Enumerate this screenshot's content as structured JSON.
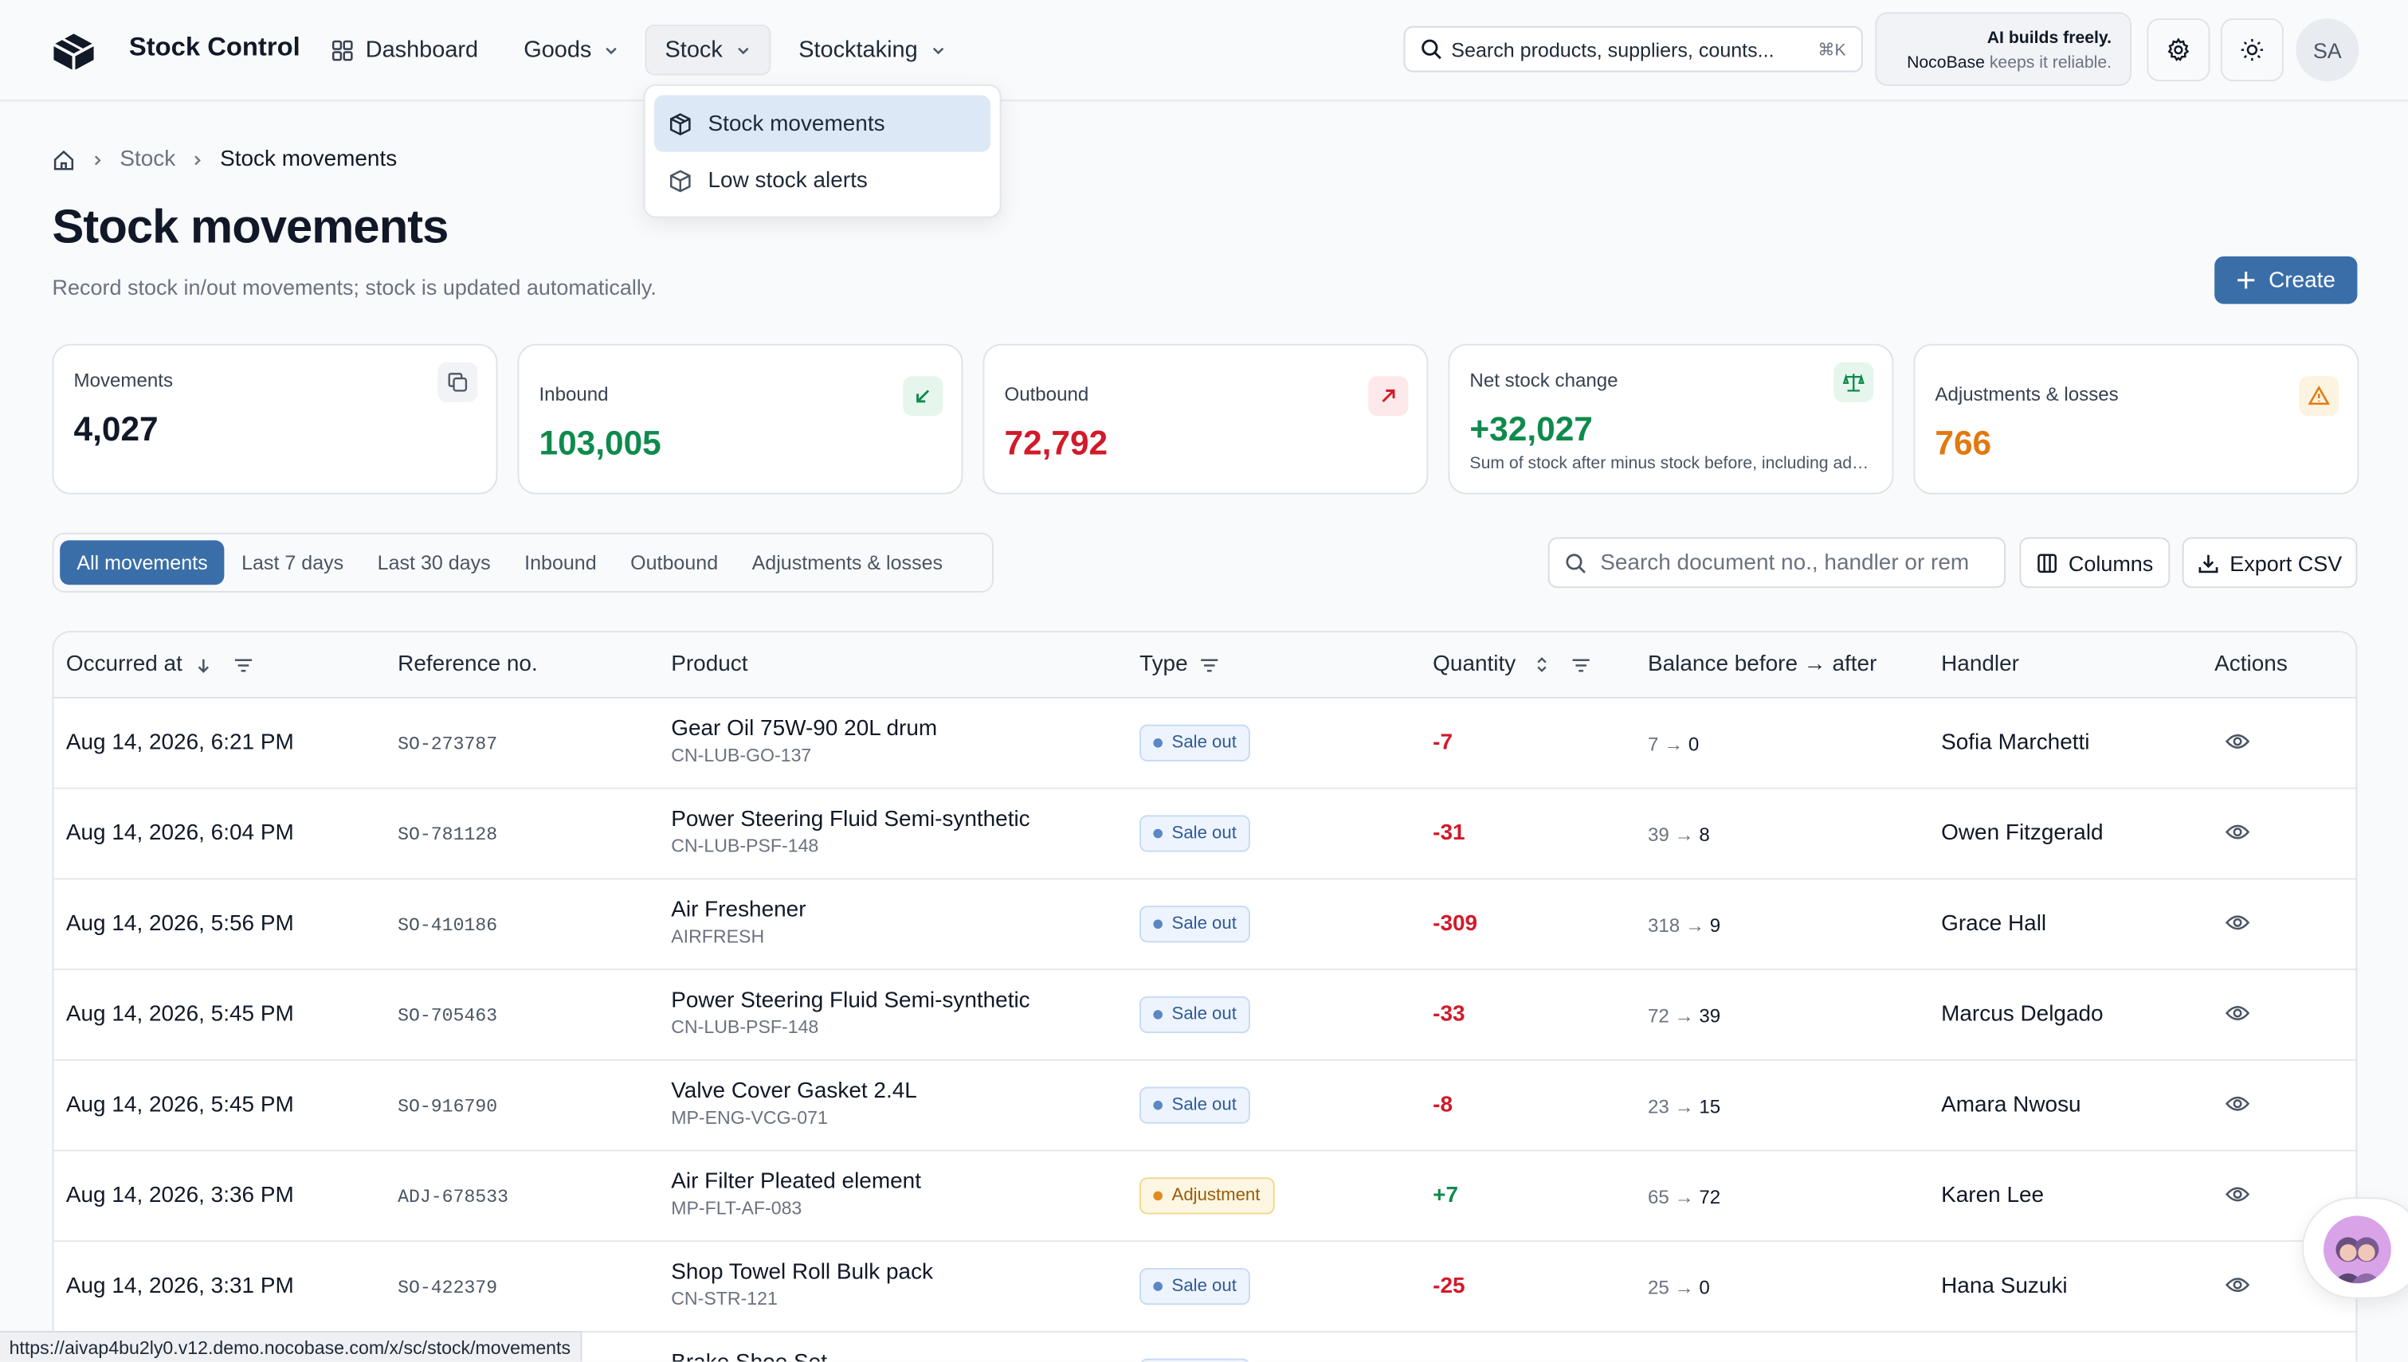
{
  "header": {
    "app_title": "Stock Control",
    "nav": [
      {
        "label": "Dashboard"
      },
      {
        "label": "Goods"
      },
      {
        "label": "Stock"
      },
      {
        "label": "Stocktaking"
      }
    ],
    "search_placeholder": "Search products, suppliers, counts...",
    "search_shortcut": "⌘K",
    "ai_line1": "AI builds freely.",
    "ai_brand": "NocoBase",
    "ai_line2": "keeps it reliable.",
    "avatar_initials": "SA"
  },
  "dropdown": {
    "items": [
      {
        "label": "Stock movements"
      },
      {
        "label": "Low stock alerts"
      }
    ]
  },
  "breadcrumb": {
    "parent": "Stock",
    "current": "Stock movements"
  },
  "page": {
    "title": "Stock movements",
    "subtitle": "Record stock in/out movements; stock is updated automatically.",
    "create_label": "Create"
  },
  "stats": [
    {
      "label": "Movements",
      "value": "4,027",
      "color": "#111827"
    },
    {
      "label": "Inbound",
      "value": "103,005",
      "color": "#0f8a4c"
    },
    {
      "label": "Outbound",
      "value": "72,792",
      "color": "#d11a2a"
    },
    {
      "label": "Net stock change",
      "value": "+32,027",
      "color": "#0f8a4c",
      "foot": "Sum of stock after minus stock before, including adjustments and losses"
    },
    {
      "label": "Adjustments & losses",
      "value": "766",
      "color": "#e07a10"
    }
  ],
  "filters": {
    "tabs": [
      "All movements",
      "Last 7 days",
      "Last 30 days",
      "Inbound",
      "Outbound",
      "Adjustments & losses"
    ],
    "search_placeholder": "Search document no., handler or remarks",
    "columns_label": "Columns",
    "export_label": "Export CSV"
  },
  "table": {
    "columns": [
      "Occurred at",
      "Reference no.",
      "Product",
      "Type",
      "Quantity",
      "Balance before → after",
      "Handler",
      "Actions"
    ],
    "rows": [
      {
        "date": "Aug 14, 2026, 6:21 PM",
        "ref": "SO-273787",
        "product": "Gear Oil 75W-90 20L drum",
        "sku": "CN-LUB-GO-137",
        "type": "Sale out",
        "qty": "-7",
        "before": "7",
        "after": "0",
        "handler": "Sofia Marchetti"
      },
      {
        "date": "Aug 14, 2026, 6:04 PM",
        "ref": "SO-781128",
        "product": "Power Steering Fluid Semi-synthetic",
        "sku": "CN-LUB-PSF-148",
        "type": "Sale out",
        "qty": "-31",
        "before": "39",
        "after": "8",
        "handler": "Owen Fitzgerald"
      },
      {
        "date": "Aug 14, 2026, 5:56 PM",
        "ref": "SO-410186",
        "product": "Air Freshener",
        "sku": "AIRFRESH",
        "type": "Sale out",
        "qty": "-309",
        "before": "318",
        "after": "9",
        "handler": "Grace Hall"
      },
      {
        "date": "Aug 14, 2026, 5:45 PM",
        "ref": "SO-705463",
        "product": "Power Steering Fluid Semi-synthetic",
        "sku": "CN-LUB-PSF-148",
        "type": "Sale out",
        "qty": "-33",
        "before": "72",
        "after": "39",
        "handler": "Marcus Delgado"
      },
      {
        "date": "Aug 14, 2026, 5:45 PM",
        "ref": "SO-916790",
        "product": "Valve Cover Gasket 2.4L",
        "sku": "MP-ENG-VCG-071",
        "type": "Sale out",
        "qty": "-8",
        "before": "23",
        "after": "15",
        "handler": "Amara Nwosu"
      },
      {
        "date": "Aug 14, 2026, 3:36 PM",
        "ref": "ADJ-678533",
        "product": "Air Filter Pleated element",
        "sku": "MP-FLT-AF-083",
        "type": "Adjustment",
        "qty": "+7",
        "before": "65",
        "after": "72",
        "handler": "Karen Lee"
      },
      {
        "date": "Aug 14, 2026, 3:31 PM",
        "ref": "SO-422379",
        "product": "Shop Towel Roll Bulk pack",
        "sku": "CN-STR-121",
        "type": "Sale out",
        "qty": "-25",
        "before": "25",
        "after": "0",
        "handler": "Hana Suzuki"
      },
      {
        "date": "",
        "ref": "",
        "product": "Brake Shoe Set",
        "sku": "",
        "type": "Sale out",
        "qty": "",
        "before": "",
        "after": "",
        "handler": ""
      }
    ]
  },
  "status_url": "https://aivap4bu2ly0.v12.demo.nocobase.com/x/sc/stock/movements"
}
